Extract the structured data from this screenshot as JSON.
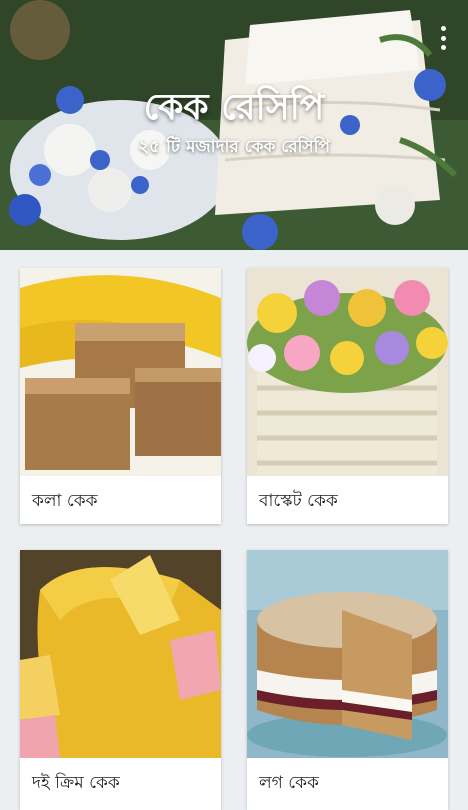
{
  "header": {
    "title": "কেক রেসিপি",
    "subtitle": "২৫ টি মজাদার কেক রেসিপি",
    "menu_icon": "more-vert-icon"
  },
  "recipes": [
    {
      "label": "কলা কেক"
    },
    {
      "label": "বাস্কেট কেক"
    },
    {
      "label": "দই ক্রিম কেক"
    },
    {
      "label": "লগ কেক"
    }
  ],
  "colors": {
    "background": "#eceff1",
    "card": "#ffffff",
    "text": "#222222"
  }
}
